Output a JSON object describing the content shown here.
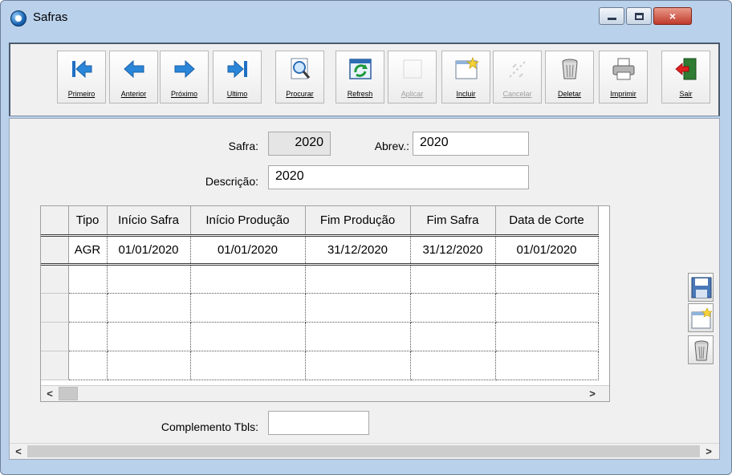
{
  "window": {
    "title": "Safras",
    "minimize_glyph": "",
    "close_glyph": "×"
  },
  "toolbar": {
    "buttons": [
      {
        "label": "Primeiro",
        "icon": "first-record-icon",
        "enabled": true
      },
      {
        "label": "Anterior",
        "icon": "previous-record-icon",
        "enabled": true
      },
      {
        "label": "Próximo",
        "icon": "next-record-icon",
        "enabled": true
      },
      {
        "label": "Ultimo",
        "icon": "last-record-icon",
        "enabled": true
      },
      {
        "label": "Procurar",
        "icon": "search-icon",
        "enabled": true
      },
      {
        "label": "Refresh",
        "icon": "refresh-icon",
        "enabled": true
      },
      {
        "label": "Aplicar",
        "icon": "apply-icon",
        "enabled": false
      },
      {
        "label": "Incluir",
        "icon": "new-record-icon",
        "enabled": true
      },
      {
        "label": "Cancelar",
        "icon": "cancel-icon",
        "enabled": false
      },
      {
        "label": "Deletar",
        "icon": "trash-icon",
        "enabled": true
      },
      {
        "label": "Imprimir",
        "icon": "printer-icon",
        "enabled": true
      },
      {
        "label": "Sair",
        "icon": "exit-icon",
        "enabled": true
      }
    ]
  },
  "form": {
    "safra_label": "Safra:",
    "safra_value": "2020",
    "abrev_label": "Abrev.:",
    "abrev_value": "2020",
    "descricao_label": "Descrição:",
    "descricao_value": "2020",
    "complemento_label": "Complemento Tbls:",
    "complemento_value": ""
  },
  "grid": {
    "columns": [
      "Tipo",
      "Início Safra",
      "Início Produção",
      "Fim Produção",
      "Fim Safra",
      "Data de Corte"
    ],
    "rows": [
      [
        "AGR",
        "01/01/2020",
        "01/01/2020",
        "31/12/2020",
        "31/12/2020",
        "01/01/2020"
      ],
      [
        "",
        "",
        "",
        "",
        "",
        ""
      ],
      [
        "",
        "",
        "",
        "",
        "",
        ""
      ],
      [
        "",
        "",
        "",
        "",
        "",
        ""
      ],
      [
        "",
        "",
        "",
        "",
        "",
        ""
      ]
    ],
    "scroll_left": "<",
    "scroll_right": ">"
  },
  "side_buttons": [
    "save-icon",
    "new-record-icon",
    "trash-icon"
  ],
  "page_scroll": {
    "left": "<",
    "right": ">"
  }
}
